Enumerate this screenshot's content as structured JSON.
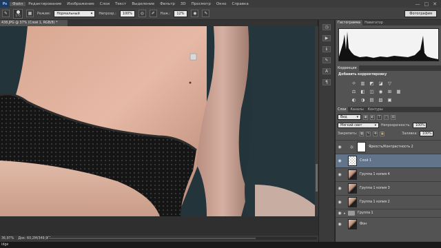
{
  "menubar": {
    "logo": "Ps",
    "items": [
      "Файл",
      "Редактирование",
      "Изображение",
      "Слои",
      "Текст",
      "Выделение",
      "Фильтр",
      "3D",
      "Просмотр",
      "Окно",
      "Справка"
    ],
    "controls": [
      "—",
      "□",
      "✕"
    ]
  },
  "options": {
    "brush_size": "175",
    "mode_label": "Режим:",
    "mode_value": "Нормальный",
    "opacity_label": "Непрозр.:",
    "opacity_value": "100%",
    "flow_label": "Наж.:",
    "flow_value": "12%",
    "workspace": "Фотография"
  },
  "document": {
    "tab_title": "438.JPG @ 37% (Слой 1, RGB/8) *"
  },
  "status": {
    "zoom": "36,97%",
    "doc_size": "Док: 60,2M/349,9M",
    "taskbar": "idge"
  },
  "panels": {
    "histogram_tabs": [
      "Гистограмма",
      "Навигатор"
    ],
    "adjustment_tabs": [
      "Коррекция"
    ],
    "adjustment_title": "Добавить корректировку",
    "adjust_icons_row1": [
      "☼",
      "▥",
      "◩",
      "◪",
      "▽"
    ],
    "adjust_icons_row2": [
      "⚖",
      "◧",
      "◫",
      "◉",
      "⊞",
      "▦"
    ],
    "adjust_icons_row3": [
      "◐",
      "◑",
      "▤",
      "▨",
      "▣"
    ],
    "layers_tabs": [
      "Слои",
      "Каналы",
      "Контуры"
    ],
    "kind_label": "Вид",
    "blend_mode": "Мягкий свет",
    "opacity_label": "Непрозрачность:",
    "opacity_value": "100%",
    "lock_label": "Закрепить:",
    "fill_label": "Заливка:",
    "fill_value": "100%",
    "layers": [
      {
        "name": "Яркость/Контрастность 2",
        "kind": "adjustment"
      },
      {
        "name": "Слой 1",
        "kind": "transparent",
        "selected": true
      },
      {
        "name": "Группа 1 копия 4",
        "kind": "photo"
      },
      {
        "name": "Группа 1 копия 3",
        "kind": "photo"
      },
      {
        "name": "Группа 1 копия 2",
        "kind": "photo"
      },
      {
        "name": "Группа 1",
        "kind": "group"
      },
      {
        "name": "Фон",
        "kind": "photo"
      }
    ]
  }
}
